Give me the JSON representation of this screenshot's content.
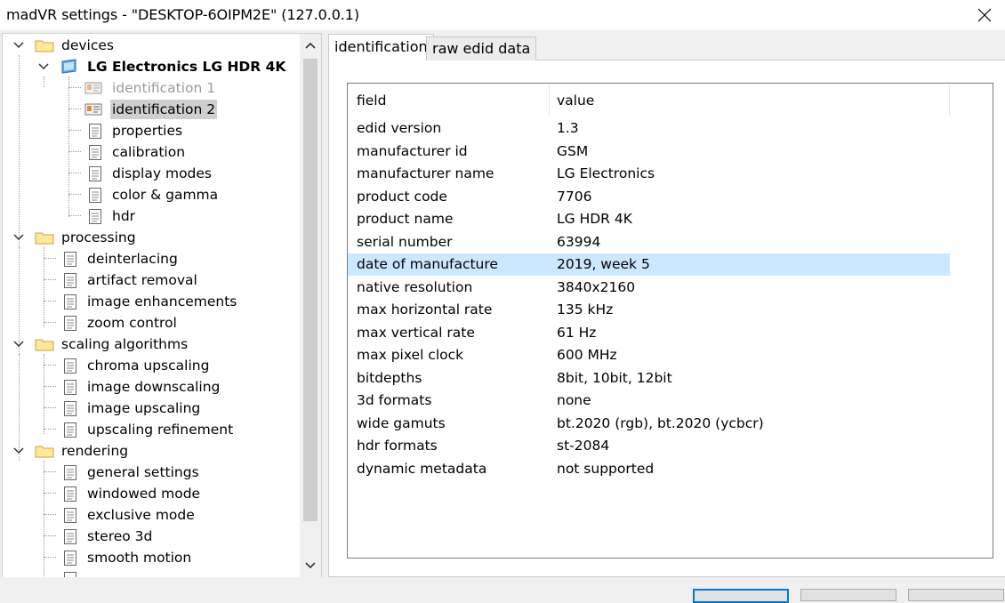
{
  "window": {
    "title": "madVR settings - \"DESKTOP-6OIPM2E\" (127.0.0.1)"
  },
  "tree": {
    "devices": "devices",
    "device_name": "LG Electronics LG HDR 4K",
    "identification_1": "identification 1",
    "identification_2": "identification 2",
    "properties": "properties",
    "calibration": "calibration",
    "display_modes": "display modes",
    "color_gamma": "color & gamma",
    "hdr": "hdr",
    "processing": "processing",
    "deinterlacing": "deinterlacing",
    "artifact_removal": "artifact removal",
    "image_enhancements": "image enhancements",
    "zoom_control": "zoom control",
    "scaling_algorithms": "scaling algorithms",
    "chroma_upscaling": "chroma upscaling",
    "image_downscaling": "image downscaling",
    "image_upscaling": "image upscaling",
    "upscaling_refinement": "upscaling refinement",
    "rendering": "rendering",
    "general_settings": "general settings",
    "windowed_mode": "windowed mode",
    "exclusive_mode": "exclusive mode",
    "stereo_3d": "stereo 3d",
    "smooth_motion": "smooth motion"
  },
  "tabs": {
    "identification": "identification",
    "raw_edid": "raw edid data"
  },
  "table": {
    "col_field": "field",
    "col_value": "value",
    "rows": [
      {
        "field": "edid version",
        "value": "1.3"
      },
      {
        "field": "manufacturer id",
        "value": "GSM"
      },
      {
        "field": "manufacturer name",
        "value": "LG Electronics"
      },
      {
        "field": "product code",
        "value": "7706"
      },
      {
        "field": "product name",
        "value": "LG HDR 4K"
      },
      {
        "field": "serial number",
        "value": "63994"
      },
      {
        "field": "date of manufacture",
        "value": "2019, week 5"
      },
      {
        "field": "native resolution",
        "value": "3840x2160"
      },
      {
        "field": "max horizontal rate",
        "value": "135 kHz"
      },
      {
        "field": "max vertical rate",
        "value": "61 Hz"
      },
      {
        "field": "max pixel clock",
        "value": "600 MHz"
      },
      {
        "field": "bitdepths",
        "value": "8bit, 10bit, 12bit"
      },
      {
        "field": "3d formats",
        "value": "none"
      },
      {
        "field": "wide gamuts",
        "value": "bt.2020 (rgb), bt.2020 (ycbcr)"
      },
      {
        "field": "hdr formats",
        "value": "st-2084"
      },
      {
        "field": "dynamic metadata",
        "value": "not supported"
      }
    ]
  },
  "colors": {
    "selection_highlight": "#cce8ff",
    "tree_selected": "#cfcfcf",
    "primary_button_border": "#0078d7"
  },
  "icons": [
    "close-icon",
    "folder-icon",
    "monitor-icon",
    "identification-icon",
    "page-icon",
    "chevron-down-icon",
    "chevron-right-icon",
    "scroll-up-icon",
    "scroll-down-icon"
  ]
}
